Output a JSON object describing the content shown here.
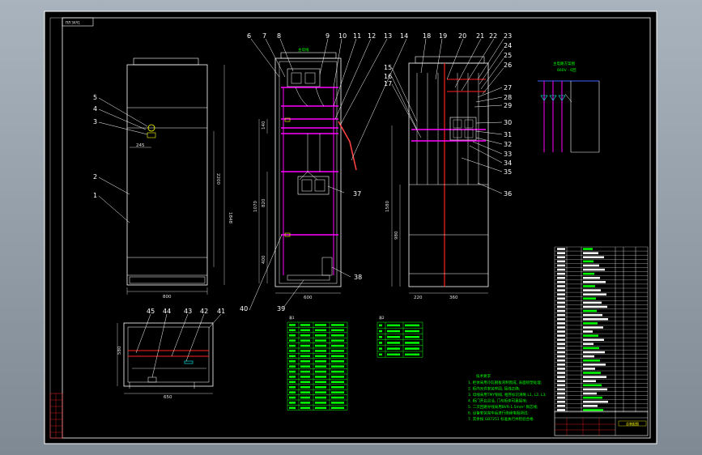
{
  "sheet": {
    "stamp_top_left": "ПЛ ЗАЧ1",
    "title_block_name": "总装配图"
  },
  "callouts": {
    "front_left": [
      "5",
      "4",
      "3",
      "2",
      "1"
    ],
    "middle_top": [
      "6",
      "7",
      "8",
      "9",
      "10",
      "11",
      "12",
      "13",
      "14"
    ],
    "right_top": [
      "18",
      "19",
      "20",
      "21",
      "22",
      "23",
      "24",
      "25",
      "26"
    ],
    "right_side": [
      "27",
      "28",
      "29",
      "30",
      "31",
      "32",
      "33",
      "34",
      "35",
      "36"
    ],
    "left_side_right_view": [
      "15",
      "16",
      "17"
    ],
    "middle_misc": [
      "37",
      "38",
      "39",
      "40"
    ],
    "bottom_plan": [
      "45",
      "44",
      "43",
      "42",
      "41"
    ]
  },
  "dimensions": {
    "front_width": "800",
    "front_height": "1848",
    "front_upper": "2200",
    "front_offset": "245",
    "middle_width": "600",
    "middle_h1": "1070",
    "middle_h2": "820",
    "middle_h3": "400",
    "middle_h4": "140",
    "right_w1": "220",
    "right_w2": "360",
    "right_h1": "1580",
    "right_h2": "980",
    "plan_width": "650",
    "plan_depth": "580"
  },
  "top_label": "主母线",
  "schematic": {
    "caption_line1": "主电路方案图",
    "caption_line2": "660V - 6回"
  },
  "tables": {
    "table1_title": "表1",
    "table2_title": "表2",
    "table1_rows": 17,
    "table2_rows": 6
  },
  "notes": {
    "title": "技术要求",
    "lines": [
      "1. 柜体采用冷轧钢板弯制而成, 表面喷塑处理;",
      "2. 柜内元件安装牢固, 接线正确;",
      "3. 母线采用TMY铜排, 相序标识清晰 L1, L2, L3;",
      "4. 柜门开启灵活, 门与柜体可靠接地;",
      "5. 二次回路导线采用BVR-1.5mm² 铜芯线;",
      "6. 设备安装完毕后进行绝缘电阻测试;",
      "7. 其余按 GB7251 标准执行并检验合格."
    ]
  },
  "colors": {
    "paper": "#000000",
    "frame": "#ffffff",
    "red": "#ff2020",
    "magenta": "#ff00ff",
    "green": "#00ff00",
    "cyan": "#00ffff",
    "yellow": "#ffff00",
    "blue": "#4060ff"
  }
}
